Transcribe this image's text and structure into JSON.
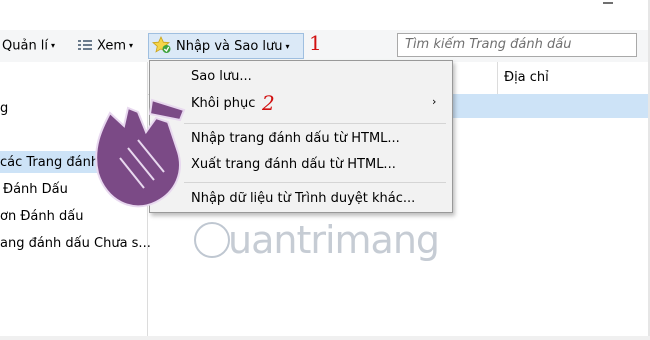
{
  "toolbar": {
    "organize_label": "Quản lí",
    "views_label": "Xem",
    "import_backup_label": "Nhập và Sao lưu",
    "search_placeholder": "Tìm kiếm Trang đánh dấu"
  },
  "markers": {
    "one": "1",
    "two": "2"
  },
  "tree": {
    "items": [
      "g",
      "các Trang đánh",
      "Đánh Dấu",
      "ơn Đánh dấu",
      "ang đánh dấu Chưa s..."
    ]
  },
  "list": {
    "column_address": "Địa chỉ"
  },
  "menu": {
    "items": [
      "Sao lưu...",
      "Khôi phục",
      "Nhập trang đánh dấu từ HTML...",
      "Xuất trang đánh dấu từ HTML...",
      "Nhập dữ liệu từ Trình duyệt khác..."
    ],
    "submenu_arrow": "›"
  },
  "watermark": {
    "text": "uantrimang"
  },
  "icons": {
    "caret": "▾",
    "close": "✕"
  },
  "colors": {
    "selection": "#cde3f7",
    "marker_red": "#d11010",
    "hand_purple": "#7b4a86"
  }
}
